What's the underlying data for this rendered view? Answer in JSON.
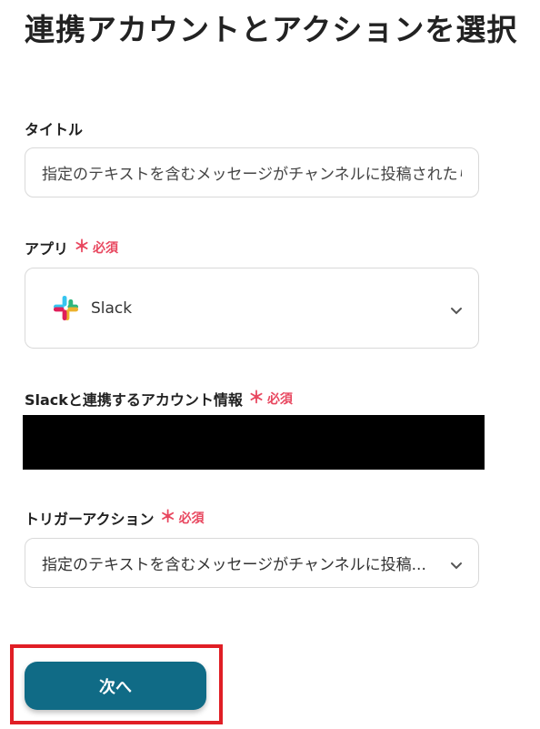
{
  "page": {
    "title": "連携アカウントとアクションを選択"
  },
  "form": {
    "title_label": "タイトル",
    "title_value": "指定のテキストを含むメッセージがチャンネルに投稿されたら",
    "app_label": "アプリ",
    "app_value": "Slack",
    "app_icon": "slack-logo-icon",
    "account_label": "Slackと連携するアカウント情報",
    "trigger_label": "トリガーアクション",
    "trigger_value": "指定のテキストを含むメッセージがチャンネルに投稿...",
    "required_star": "＊",
    "required_text": "必須"
  },
  "buttons": {
    "next_label": "次へ"
  },
  "colors": {
    "primary": "#106b86",
    "required": "#e8475f",
    "highlight": "#e01e25"
  }
}
